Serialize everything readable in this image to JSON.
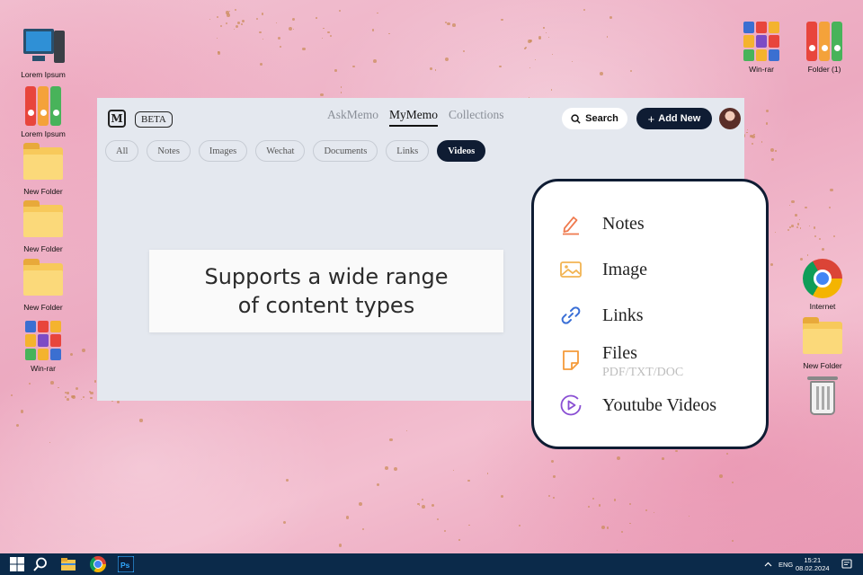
{
  "desktop": {
    "left_icons": [
      {
        "label": "Lorem Ipsum",
        "icon": "computer-icon"
      },
      {
        "label": "Lorem Ipsum",
        "icon": "binders-icon"
      },
      {
        "label": "New Folder",
        "icon": "folder-icon"
      },
      {
        "label": "New Folder",
        "icon": "folder-icon"
      },
      {
        "label": "New Folder",
        "icon": "folder-icon"
      },
      {
        "label": "Win-rar",
        "icon": "winrar-icon"
      }
    ],
    "right_icons": [
      {
        "label": "Win-rar",
        "icon": "winrar-icon"
      },
      {
        "label": "Folder (1)",
        "icon": "binders-icon"
      },
      {
        "label": "Internet",
        "icon": "chrome-icon"
      },
      {
        "label": "New Folder",
        "icon": "folder-icon"
      },
      {
        "label": "",
        "icon": "trash-icon"
      }
    ]
  },
  "app": {
    "logo_letter": "M",
    "beta_label": "BETA",
    "nav_tabs": [
      {
        "label": "AskMemo",
        "active": false
      },
      {
        "label": "MyMemo",
        "active": true
      },
      {
        "label": "Collections",
        "active": false
      }
    ],
    "search_label": "Search",
    "add_new_label": "Add New",
    "filters": [
      {
        "label": "All",
        "active": false
      },
      {
        "label": "Notes",
        "active": false
      },
      {
        "label": "Images",
        "active": false
      },
      {
        "label": "Wechat",
        "active": false
      },
      {
        "label": "Documents",
        "active": false
      },
      {
        "label": "Links",
        "active": false
      },
      {
        "label": "Videos",
        "active": true
      }
    ]
  },
  "caption": {
    "line1": "Supports a wide range",
    "line2": "of content types"
  },
  "content_types": [
    {
      "label": "Notes",
      "icon": "pencil-icon",
      "color": "#ef7a4e"
    },
    {
      "label": "Image",
      "icon": "image-icon",
      "color": "#f2b453"
    },
    {
      "label": "Links",
      "icon": "link-icon",
      "color": "#3a6fd6"
    },
    {
      "label": "Files",
      "sublabel": "PDF/TXT/DOC",
      "icon": "file-icon",
      "color": "#f59b3a"
    },
    {
      "label": "Youtube Videos",
      "icon": "play-circle-icon",
      "color": "#8a4fd3"
    }
  ],
  "taskbar": {
    "lang": "ENG",
    "time": "15:21",
    "date": "08.02.2024"
  }
}
